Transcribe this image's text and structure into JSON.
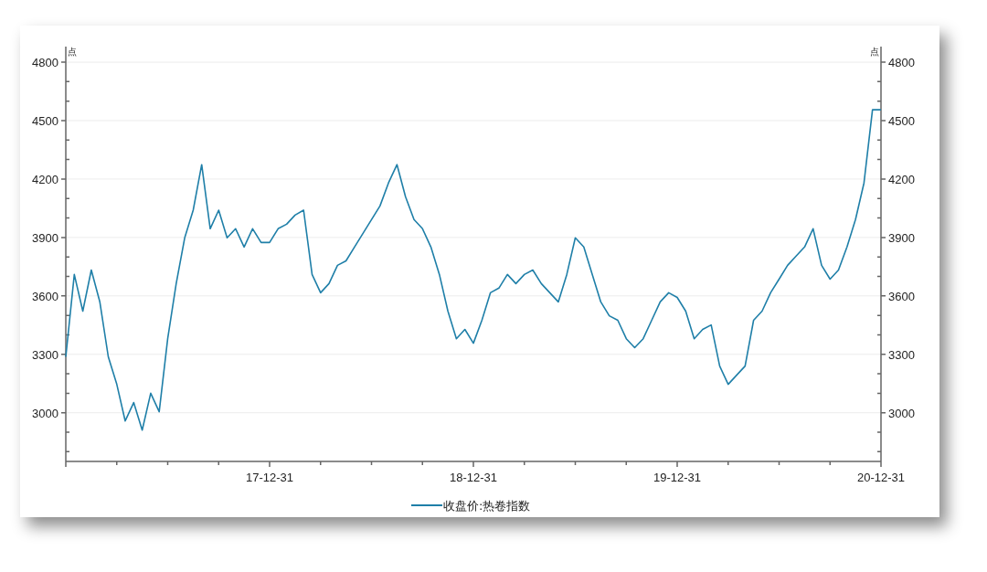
{
  "chart": {
    "chart_data": {
      "type": "line",
      "ylabel": "点",
      "categories": [
        null,
        null,
        null,
        null,
        null,
        null,
        null,
        null,
        null,
        null,
        null,
        null,
        null,
        null,
        null,
        null,
        null,
        null,
        null,
        null,
        null,
        null,
        null,
        null,
        "17-12-31",
        null,
        null,
        null,
        null,
        null,
        null,
        null,
        null,
        null,
        null,
        null,
        null,
        null,
        null,
        null,
        null,
        null,
        null,
        null,
        null,
        null,
        null,
        null,
        "18-12-31",
        null,
        null,
        null,
        null,
        null,
        null,
        null,
        null,
        null,
        null,
        null,
        null,
        null,
        null,
        null,
        null,
        null,
        null,
        null,
        null,
        null,
        null,
        null,
        "19-12-31",
        null,
        null,
        null,
        null,
        null,
        null,
        null,
        null,
        null,
        null,
        null,
        null,
        null,
        null,
        null,
        null,
        null,
        null,
        null,
        null,
        null,
        null,
        null,
        "20-12-31"
      ],
      "series": [
        {
          "name": "收盘价:热卷指数",
          "color": "#1f7fa8",
          "values": [
            3287,
            3710,
            3522,
            3733,
            3570,
            3287,
            3146,
            2958,
            3052,
            2911,
            3100,
            3005,
            3380,
            3663,
            3898,
            4040,
            4274,
            3945,
            4040,
            3898,
            3945,
            3851,
            3945,
            3874,
            3874,
            3945,
            3968,
            4015,
            4040,
            3710,
            3616,
            3663,
            3757,
            3780,
            3851,
            3921,
            3992,
            4062,
            4180,
            4274,
            4109,
            3992,
            3945,
            3851,
            3710,
            3522,
            3380,
            3428,
            3357,
            3475,
            3616,
            3640,
            3710,
            3663,
            3710,
            3733,
            3663,
            3616,
            3569,
            3710,
            3898,
            3851,
            3710,
            3569,
            3498,
            3475,
            3380,
            3334,
            3380,
            3475,
            3569,
            3616,
            3592,
            3522,
            3380,
            3428,
            3451,
            3240,
            3146,
            3193,
            3240,
            3475,
            3522,
            3616,
            3686,
            3757,
            3804,
            3851,
            3945,
            3757,
            3686,
            3733,
            3851,
            3992,
            4180,
            4556,
            4556
          ]
        }
      ],
      "ylim": [
        2750,
        4880
      ],
      "grid": true,
      "yticks": [
        3000,
        3300,
        3600,
        3900,
        4200,
        4500,
        4800
      ]
    },
    "right_axis": {
      "unit": "点",
      "ticks": [
        "4800",
        "4500",
        "4200",
        "3900",
        "3600",
        "3300",
        "3000"
      ]
    }
  }
}
